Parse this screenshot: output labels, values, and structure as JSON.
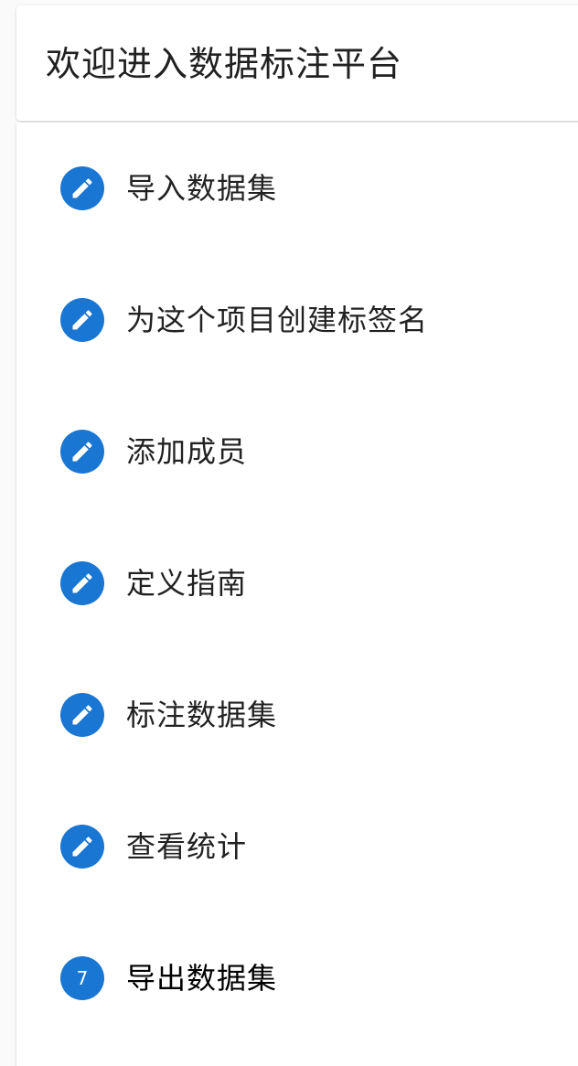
{
  "header": {
    "title": "欢迎进入数据标注平台"
  },
  "colors": {
    "accent": "#1976d2",
    "icon_foreground": "#ffffff"
  },
  "steps": [
    {
      "label": "导入数据集",
      "icon": "edit-pencil-icon",
      "state": "completed"
    },
    {
      "label": "为这个项目创建标签名",
      "icon": "edit-pencil-icon",
      "state": "completed"
    },
    {
      "label": "添加成员",
      "icon": "edit-pencil-icon",
      "state": "completed"
    },
    {
      "label": "定义指南",
      "icon": "edit-pencil-icon",
      "state": "completed"
    },
    {
      "label": "标注数据集",
      "icon": "edit-pencil-icon",
      "state": "completed"
    },
    {
      "label": "查看统计",
      "icon": "edit-pencil-icon",
      "state": "completed"
    },
    {
      "label": "导出数据集",
      "number": "7",
      "state": "active"
    }
  ]
}
